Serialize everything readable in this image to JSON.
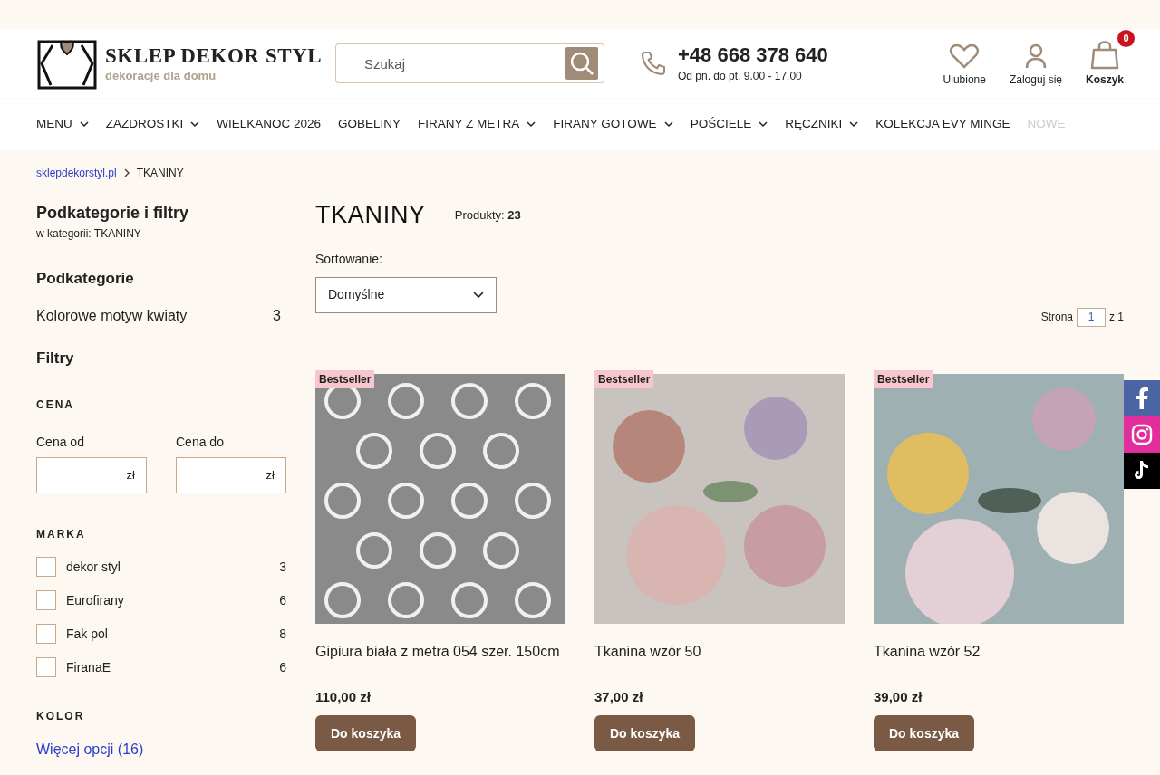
{
  "header": {
    "logo_title": "SKLEP DEKOR STYL",
    "logo_tagline": "dekoracje dla domu",
    "search": {
      "placeholder": "Szukaj"
    },
    "phone": "+48 668 378 640",
    "hours": "Od pn. do pt. 9.00 - 17.00",
    "favorites": "Ulubione",
    "login": "Zaloguj się",
    "cart": {
      "label": "Koszyk",
      "count": "0"
    }
  },
  "nav": [
    {
      "label": "MENU",
      "dropdown": true
    },
    {
      "label": "ZAZDROSTKI",
      "dropdown": true
    },
    {
      "label": "WIELKANOC 2026",
      "dropdown": false
    },
    {
      "label": "GOBELINY",
      "dropdown": false
    },
    {
      "label": "FIRANY Z METRA",
      "dropdown": true
    },
    {
      "label": "FIRANY GOTOWE",
      "dropdown": true
    },
    {
      "label": "POŚCIELE",
      "dropdown": true
    },
    {
      "label": "RĘCZNIKI",
      "dropdown": true
    },
    {
      "label": "KOLEKCJA EVY MINGE",
      "dropdown": false
    },
    {
      "label": "NOWE",
      "dropdown": false
    }
  ],
  "breadcrumb": [
    "sklepdekorstyl.pl",
    "TKANINY"
  ],
  "sidebar": {
    "title": "Podkategorie i filtry",
    "subtitle": "w kategorii: TKANINY",
    "subcategories_title": "Podkategorie",
    "subcategories": [
      {
        "label": "Kolorowe motyw kwiaty",
        "count": "3"
      }
    ],
    "filters_title": "Filtry",
    "price": {
      "title": "CENA",
      "from_label": "Cena od",
      "to_label": "Cena do",
      "currency_from": "zł",
      "currency_to": "zł"
    },
    "brand_title": "MARKA",
    "brands": [
      {
        "label": "dekor styl",
        "count": "3",
        "checked": false
      },
      {
        "label": "Eurofirany",
        "count": "6",
        "checked": false
      },
      {
        "label": "Fak pol",
        "count": "8",
        "checked": false
      },
      {
        "label": "FiranaE",
        "count": "6",
        "checked": false
      }
    ],
    "color_title": "KOLOR",
    "more_options": "Więcej opcji (16)"
  },
  "main": {
    "title": "TKANINY",
    "products_label": "Produkty:",
    "products_count": "23",
    "sort_label": "Sortowanie:",
    "sort_value": "Domyślne",
    "page_label": "Strona",
    "page_value": "1",
    "page_total": "z 1"
  },
  "products": [
    {
      "badge": "Bestseller",
      "name": "Gipiura biała z metra 054 szer. 150cm",
      "price": "110,00 zł",
      "button": "Do koszyka",
      "kind": "lace"
    },
    {
      "badge": "Bestseller",
      "name": "Tkanina wzór 50",
      "price": "37,00 zł",
      "button": "Do koszyka",
      "kind": "floral"
    },
    {
      "badge": "Bestseller",
      "name": "Tkanina wzór 52",
      "price": "39,00 zł",
      "button": "Do koszyka",
      "kind": "floral-blue"
    }
  ]
}
